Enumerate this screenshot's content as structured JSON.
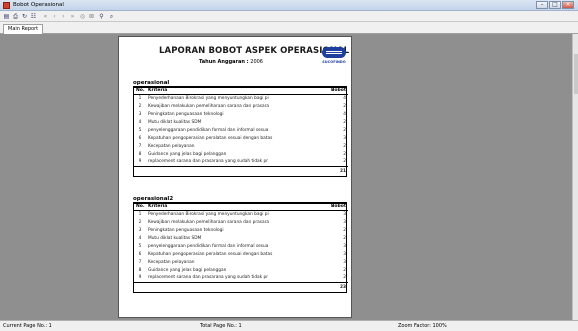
{
  "window": {
    "title": "Bobot Operasional"
  },
  "tabs": [
    {
      "label": "Main Report"
    }
  ],
  "report": {
    "title": "LAPORAN BOBOT ASPEK OPERASIONAL",
    "subtitle_label": "Tahun Anggaran :",
    "subtitle_value": "2006",
    "logo_text": "SUCOFINDO",
    "sections": [
      {
        "title": "operasional",
        "col_no": "No.",
        "col_kriteria": "Kriteria",
        "col_bobot": "Bobot",
        "rows": [
          {
            "no": "1",
            "kriteria": "Penyederhanaan Birokrasi yang menyuntungkan bagi pi",
            "bobot": "4"
          },
          {
            "no": "2",
            "kriteria": "Kewajiban melakukan pemeliharaan sarana dan prasara",
            "bobot": "2"
          },
          {
            "no": "3",
            "kriteria": "Peningkatan penguasaan teknologi",
            "bobot": "4"
          },
          {
            "no": "4",
            "kriteria": "Mutu diklat kualitas SDM",
            "bobot": "2"
          },
          {
            "no": "5",
            "kriteria": "penyelenggaraan pendidikan formal dan informal sesua",
            "bobot": "2"
          },
          {
            "no": "6",
            "kriteria": "Kepatuhan pengoperasian peralatan sesuai dengan batas",
            "bobot": "3"
          },
          {
            "no": "7",
            "kriteria": "Kecepatan pelayanan",
            "bobot": "2"
          },
          {
            "no": "8",
            "kriteria": "Guidance yang jelas bagi pelanggan",
            "bobot": "2"
          },
          {
            "no": "9",
            "kriteria": "replacement sarana dan prasarana yang sudah tidak pr",
            "bobot": "2"
          }
        ],
        "total": "21"
      },
      {
        "title": "operasional2",
        "col_no": "No.",
        "col_kriteria": "Kriteria",
        "col_bobot": "Bobot",
        "rows": [
          {
            "no": "1",
            "kriteria": "Penyederhanaan Birokrasi yang menyuntungkan bagi pi",
            "bobot": "3"
          },
          {
            "no": "2",
            "kriteria": "Kewajiban melakukan pemeliharaan sarana dan prasara",
            "bobot": "3"
          },
          {
            "no": "3",
            "kriteria": "Peningkatan penguasaan teknologi",
            "bobot": "2"
          },
          {
            "no": "4",
            "kriteria": "Mutu diklat kualitas SDM",
            "bobot": "2"
          },
          {
            "no": "5",
            "kriteria": "penyelenggaraan pendidikan formal dan informal sesua",
            "bobot": "3"
          },
          {
            "no": "6",
            "kriteria": "Kepatuhan pengoperasian peralatan sesuai dengan batas",
            "bobot": "3"
          },
          {
            "no": "7",
            "kriteria": "Kecepatan pelayanan",
            "bobot": "3"
          },
          {
            "no": "8",
            "kriteria": "Guidance yang jelas bagi pelanggan",
            "bobot": "2"
          },
          {
            "no": "9",
            "kriteria": "replacement sarana dan prasarana yang sudah tidak pr",
            "bobot": "2"
          }
        ],
        "total": "23"
      }
    ]
  },
  "status": {
    "current_page": "Current Page No.: 1",
    "total_page": "Total Page No.: 1",
    "zoom": "Zoom Factor: 100%"
  }
}
